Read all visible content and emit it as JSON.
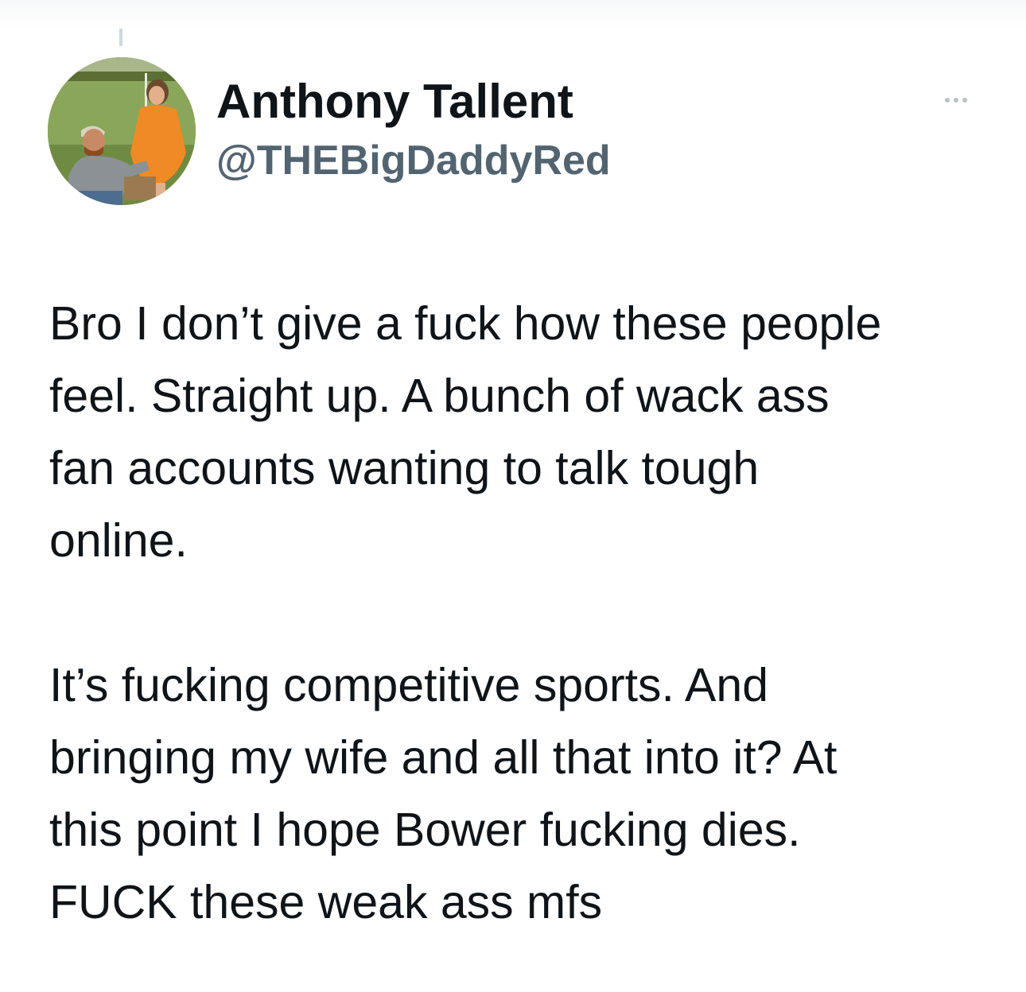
{
  "tweet": {
    "author": {
      "display_name": "Anthony Tallent",
      "handle": "@THEBigDaddyRed",
      "avatar_icon": "profile-photo"
    },
    "more_icon": "more-options-icon",
    "paragraphs": [
      {
        "lines": [
          "Bro I don’t give a fuck how these people",
          "feel. Straight up. A bunch of wack ass",
          "fan accounts wanting to talk tough",
          "online."
        ]
      },
      {
        "lines": [
          "It’s fucking competitive sports. And",
          "bringing my wife and all that into it? At",
          "this point I hope Bower fucking dies.",
          "FUCK these weak ass mfs"
        ]
      }
    ]
  },
  "colors": {
    "text_primary": "#0f1419",
    "text_secondary": "#536471",
    "thread_line": "#cfd9de",
    "background": "#ffffff"
  }
}
